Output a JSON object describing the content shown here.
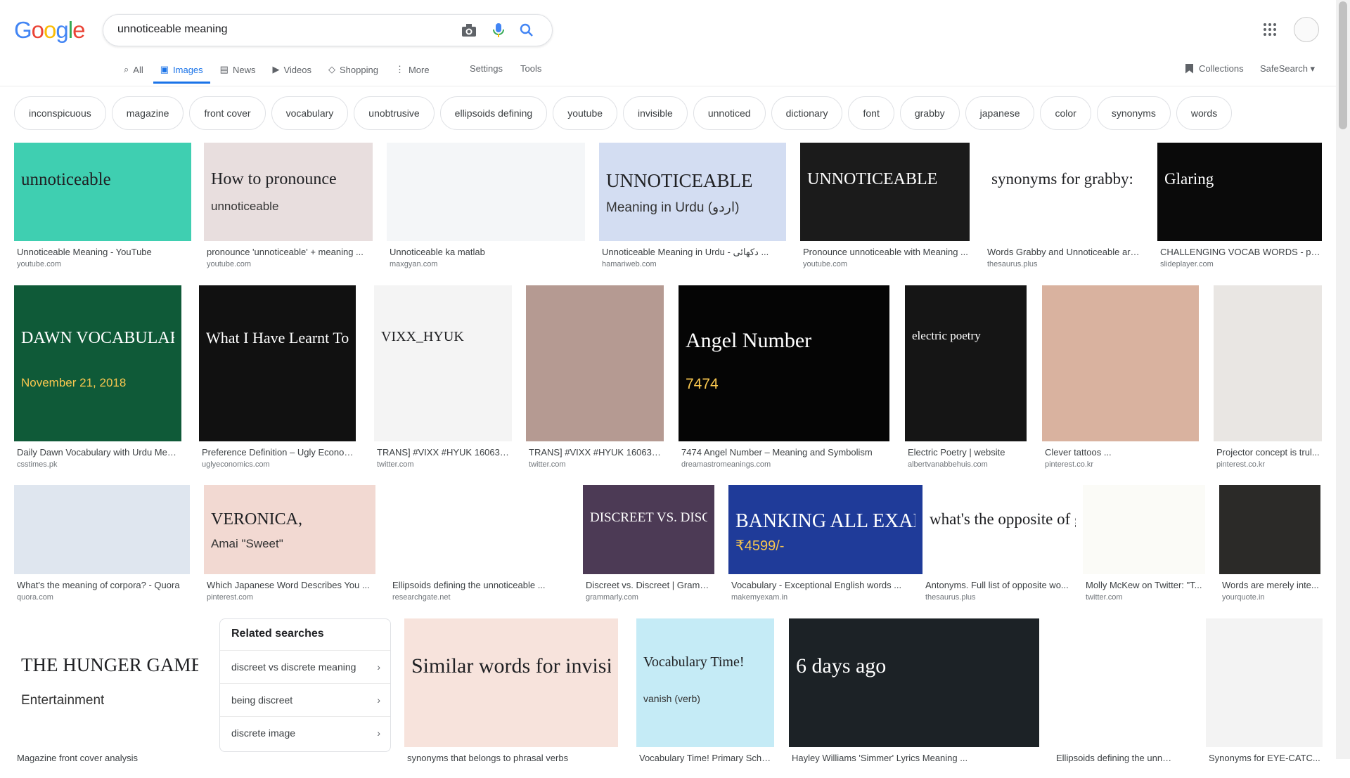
{
  "search": {
    "query": "unnoticeable meaning"
  },
  "logo": {
    "letters": [
      "G",
      "o",
      "o",
      "g",
      "l",
      "e"
    ],
    "colors": [
      "#4285f4",
      "#ea4335",
      "#fbbc05",
      "#4285f4",
      "#34a853",
      "#ea4335"
    ]
  },
  "tabs": [
    {
      "label": "All",
      "icon": "search-icon"
    },
    {
      "label": "Images",
      "icon": "image-icon",
      "active": true
    },
    {
      "label": "News",
      "icon": "news-icon"
    },
    {
      "label": "Videos",
      "icon": "video-icon"
    },
    {
      "label": "Shopping",
      "icon": "tag-icon"
    },
    {
      "label": "More",
      "icon": "dots-icon"
    }
  ],
  "tools": {
    "settings": "Settings",
    "tools": "Tools",
    "collections": "Collections",
    "safesearch": "SafeSearch ▾"
  },
  "chips": [
    "inconspicuous",
    "magazine",
    "front cover",
    "vocabulary",
    "unobtrusive",
    "ellipsoids defining",
    "youtube",
    "invisible",
    "unnoticed",
    "dictionary",
    "font",
    "grabby",
    "japanese",
    "color",
    "synonyms",
    "words"
  ],
  "images": [
    {
      "title": "Unnoticeable Meaning - YouTube",
      "source": "youtube.com",
      "overlay": "unnoticeable",
      "bg": "#3fcfb1"
    },
    {
      "title": "pronounce 'unnoticeable' + meaning ...",
      "source": "youtube.com",
      "overlay": "How to pronounce",
      "overlay2": "unnoticeable",
      "bg": "#e8dede"
    },
    {
      "title": "Unnoticeable ka matlab",
      "source": "maxgyan.com",
      "bg": "#f4f6f8"
    },
    {
      "title": "Unnoticeable Meaning in Urdu - دکھائی ...",
      "source": "hamariweb.com",
      "overlay": "UNNOTICEABLE",
      "overlay2": "Meaning in Urdu (اردو)",
      "bg": "#d3ddf2"
    },
    {
      "title": "Pronounce unnoticeable with Meaning ...",
      "source": "youtube.com",
      "overlay": "UNNOTICEABLE",
      "bg": "#1b1b1b"
    },
    {
      "title": "Words Grabby and Unnoticeable are ...",
      "source": "thesaurus.plus",
      "overlay": "synonyms for grabby:",
      "bg": "#ffffff"
    },
    {
      "title": "CHALLENGING VOCAB WORDS - ppt...",
      "source": "slideplayer.com",
      "overlay": "Glaring",
      "bg": "#0a0a0a"
    },
    {
      "title": "Daily Dawn Vocabulary with Urdu Meani...",
      "source": "csstimes.pk",
      "overlay": "DAWN VOCABULARY",
      "overlay2": "November 21, 2018",
      "bg": "#0f5a38"
    },
    {
      "title": "Preference Definition – Ugly Econom...",
      "source": "uglyeconomics.com",
      "overlay": "What I Have Learnt Today",
      "bg": "#111111"
    },
    {
      "title": "TRANS] #VIXX #HYUK 160630 ...",
      "source": "twitter.com",
      "overlay": "VIXX_HYUK",
      "bg": "#f4f4f4"
    },
    {
      "title": "TRANS] #VIXX #HYUK 160630 ...",
      "source": "twitter.com",
      "bg": "#b59a92"
    },
    {
      "title": "7474 Angel Number – Meaning and Symbolism",
      "source": "dreamastromeanings.com",
      "overlay": "Angel Number",
      "overlay2": "7474",
      "bg": "#050505"
    },
    {
      "title": "Electric Poetry | website",
      "source": "albertvanabbehuis.com",
      "overlay": "electric poetry",
      "bg": "#151515"
    },
    {
      "title": "Clever tattoos ...",
      "source": "pinterest.co.kr",
      "bg": "#d9b29f"
    },
    {
      "title": "Projector concept is trul...",
      "source": "pinterest.co.kr",
      "bg": "#e9e6e3"
    },
    {
      "title": "What's the meaning of corpora? - Quora",
      "source": "quora.com",
      "bg": "#dfe6ef"
    },
    {
      "title": "Which Japanese Word Describes You ...",
      "source": "pinterest.com",
      "overlay": "VERONICA,",
      "overlay2": "Amai \"Sweet\"",
      "bg": "#f2d9d2"
    },
    {
      "title": "Ellipsoids defining the unnoticeable ...",
      "source": "researchgate.net",
      "bg": "#ffffff"
    },
    {
      "title": "Discreet vs. Discreet | Gramm...",
      "source": "grammarly.com",
      "overlay": "DISCREET VS. DISCRETE",
      "bg": "#4c3a55"
    },
    {
      "title": "Vocabulary - Exceptional English words ...",
      "source": "makemyexam.in",
      "overlay": "BANKING ALL EXAMS",
      "overlay2": "₹4599/-",
      "bg": "#1f3b99"
    },
    {
      "title": "Antonyms. Full list of opposite wo...",
      "source": "thesaurus.plus",
      "overlay": "what's the opposite of grabby?",
      "bg": "#ffffff"
    },
    {
      "title": "Molly McKew on Twitter: \"T...",
      "source": "twitter.com",
      "bg": "#fbfbf7"
    },
    {
      "title": "Words are merely inte...",
      "source": "yourquote.in",
      "bg": "#2b2a28"
    },
    {
      "title": "Magazine front cover analysis",
      "source": "",
      "overlay": "THE HUNGER GAMES",
      "overlay2": "Entertainment",
      "bg": "#ffffff"
    },
    {
      "title": "synonyms that belongs to phrasal verbs",
      "source": "",
      "overlay": "Similar words for invisible:",
      "bg": "#f7e3dc"
    },
    {
      "title": "Vocabulary Time! Primary Scho...",
      "source": "",
      "overlay": "Vocabulary Time!",
      "overlay2": "vanish (verb)",
      "bg": "#c5ebf6"
    },
    {
      "title": "Hayley Williams 'Simmer' Lyrics Meaning ...",
      "source": "",
      "overlay": "6 days ago",
      "bg": "#1c2226"
    },
    {
      "title": "Ellipsoids defining the unnotice...",
      "source": "",
      "bg": "#ffffff"
    },
    {
      "title": "Synonyms for EYE-CATC...",
      "source": "",
      "bg": "#f3f3f3"
    }
  ],
  "related": {
    "heading": "Related searches",
    "items": [
      "discreet vs discrete meaning",
      "being discreet",
      "discrete image"
    ]
  }
}
